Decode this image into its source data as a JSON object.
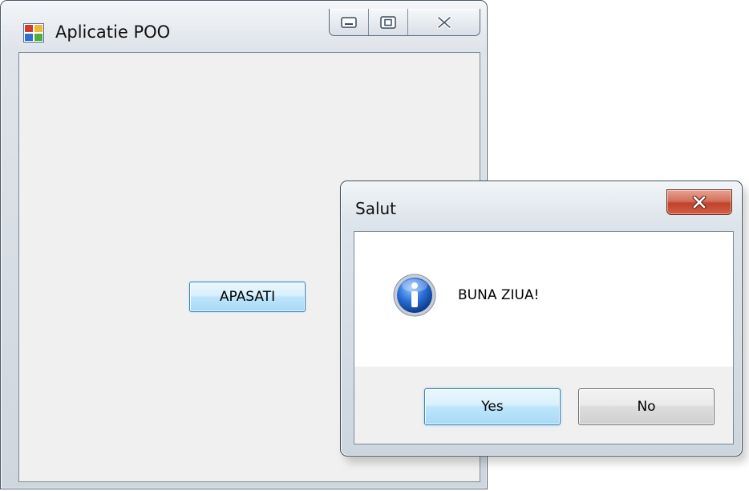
{
  "main_window": {
    "title": "Aplicatie POO",
    "icon": "form-app-icon",
    "caption_buttons": [
      "minimize-icon",
      "maximize-icon",
      "close-icon"
    ],
    "apasati_label": "APASATI"
  },
  "message_box": {
    "title": "Salut",
    "icon": "information-icon",
    "message": "BUNA ZIUA!",
    "yes_label": "Yes",
    "no_label": "No"
  },
  "colors": {
    "close_button": "#c9462c",
    "focus_button_border": "#3c7fb1",
    "window_background": "#f0f0f0"
  }
}
